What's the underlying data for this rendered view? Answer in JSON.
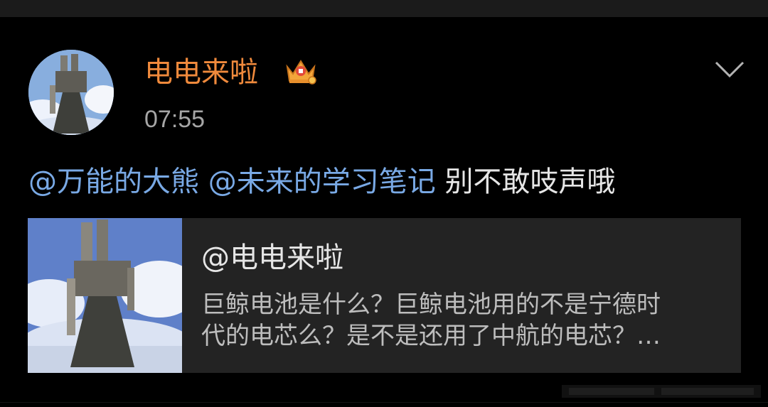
{
  "post": {
    "username": "电电来啦",
    "time": "07:55",
    "content": {
      "mention1": "@万能的大熊",
      "mention2": "@未来的学习笔记",
      "text": "别不敢吱声哦"
    }
  },
  "card": {
    "title": "@电电来啦",
    "line1": "巨鲸电池是什么？巨鲸电池用的不是宁德时",
    "line2": "代的电芯么？是不是还用了中航的电芯？…"
  },
  "icons": {
    "crown": "crown-badge-icon",
    "more": "chevron-down-icon"
  },
  "colors": {
    "username": "#f08a3c",
    "mention": "#79a9e5",
    "background": "#000000",
    "card": "#232323"
  }
}
